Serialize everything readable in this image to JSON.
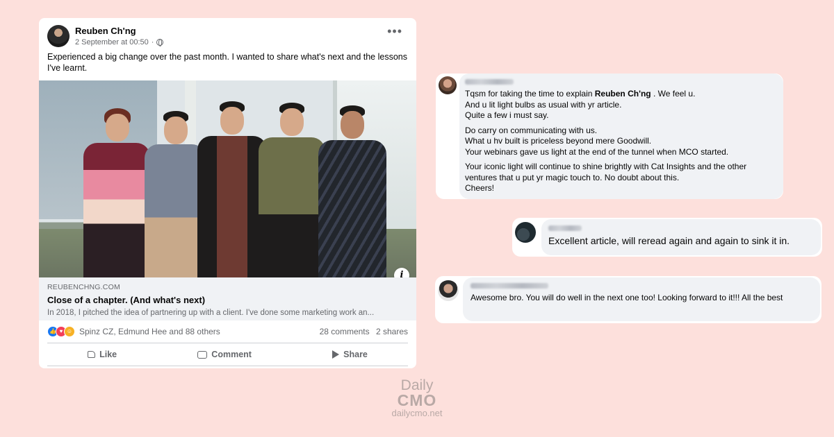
{
  "post": {
    "author": "Reuben Ch'ng",
    "timestamp": "2 September at 00:50",
    "text": "Experienced a big change over the past month. I wanted to share what's next and the lessons I've learnt.",
    "link": {
      "domain": "REUBENCHNG.COM",
      "title": "Close of a chapter. (And what's next)",
      "description": "In 2018, I pitched the idea of partnering up with a client. I've done some marketing work an..."
    },
    "reactions": {
      "names": "Spinz CZ, Edmund Hee and 88 others",
      "comments": "28 comments",
      "shares": "2 shares",
      "icons": [
        "like-icon",
        "love-icon",
        "care-icon"
      ]
    },
    "actions": {
      "like": "Like",
      "comment": "Comment",
      "share": "Share"
    }
  },
  "comments": [
    {
      "name_blurred": true,
      "paragraphs": [
        {
          "before": "Tqsm for taking the time to explain ",
          "mention": "Reuben Ch'ng",
          "after": " . We feel u."
        },
        {
          "line": "And u lit light bulbs as usual with yr article."
        },
        {
          "line": "Quite a few i must say."
        },
        {
          "line": "Do carry on communicating with us."
        },
        {
          "line": "What u hv built is priceless beyond mere Goodwill."
        },
        {
          "line": "Your webinars gave us light at the end of the tunnel when MCO started."
        },
        {
          "line": "Your iconic light will continue to shine brightly with Cat Insights and the other ventures that u put yr magic touch to. No doubt about this."
        },
        {
          "line": "Cheers!"
        }
      ]
    },
    {
      "name_blurred": true,
      "text": "Excellent article, will reread again and again to sink it in."
    },
    {
      "name_blurred": true,
      "text": "Awesome bro. You will do well in the next one too! Looking forward to it!!! All the best"
    }
  ],
  "logo": {
    "daily": "Daily",
    "cmo": "CMO",
    "url": "dailycmo.net"
  },
  "colors": {
    "background": "#fde0dc",
    "card": "#ffffff",
    "bubble": "#f0f2f5",
    "secondary_text": "#65676b",
    "like_blue": "#1877f2"
  }
}
